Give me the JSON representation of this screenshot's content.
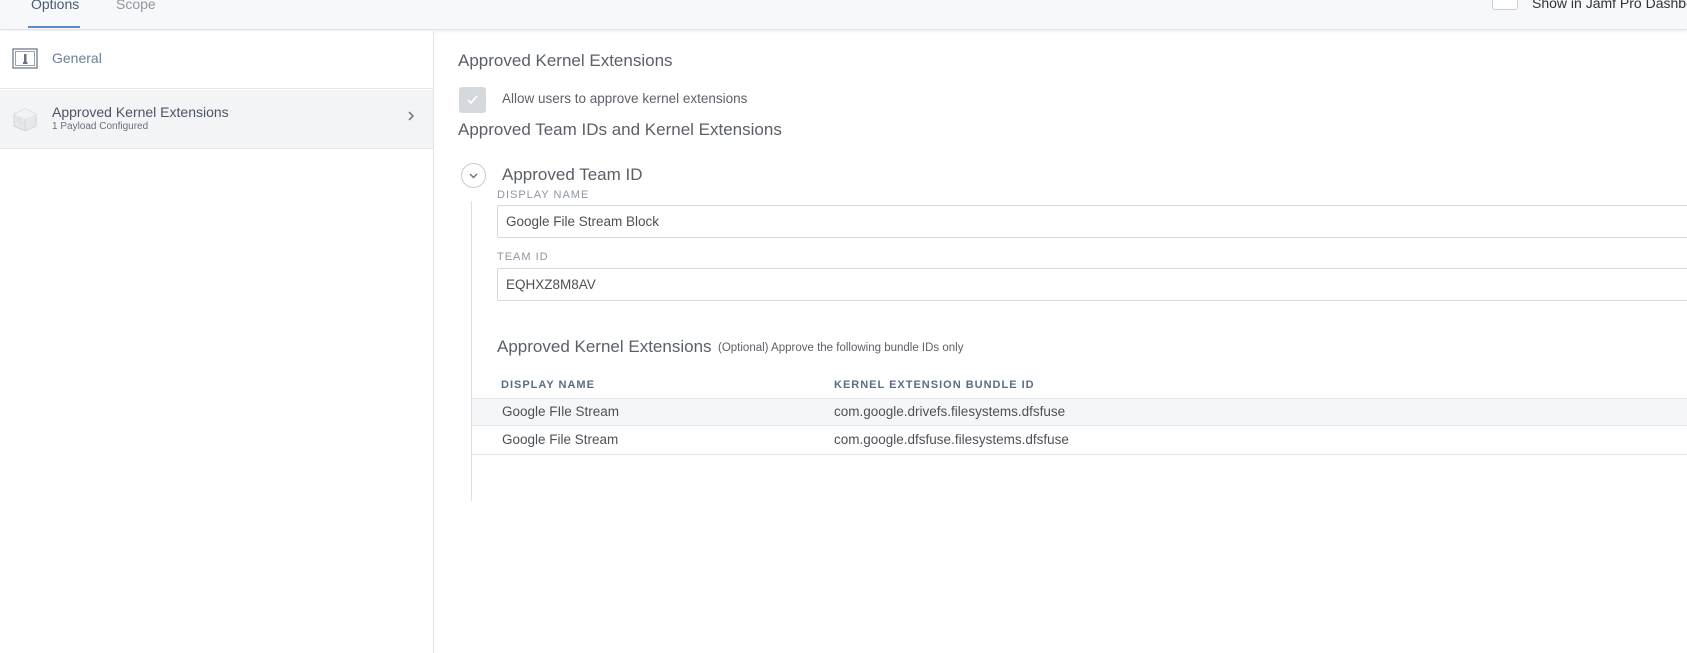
{
  "tabs": [
    {
      "label": "Options"
    },
    {
      "label": "Scope"
    }
  ],
  "header": {
    "dashboard_label": "Show in Jamf Pro Dashbo"
  },
  "sidebar": {
    "items": [
      {
        "label": "General",
        "sublabel": ""
      },
      {
        "label": "Approved Kernel Extensions",
        "sublabel": "1 Payload Configured"
      }
    ]
  },
  "main": {
    "section_title": "Approved Kernel Extensions",
    "allow_users_checkbox": {
      "label": "Allow users to approve kernel extensions",
      "checked": true
    },
    "team_section_title": "Approved Team IDs and Kernel Extensions",
    "team_group": {
      "title": "Approved Team ID",
      "display_name_label": "DISPLAY NAME",
      "display_name_value": "Google File Stream Block",
      "team_id_label": "TEAM ID",
      "team_id_value": "EQHXZ8M8AV",
      "extensions_title": "Approved Kernel Extensions",
      "extensions_hint": "(Optional) Approve the following bundle IDs only",
      "table": {
        "columns": [
          "DISPLAY NAME",
          "KERNEL EXTENSION BUNDLE ID"
        ],
        "rows": [
          [
            "Google FIle Stream",
            "com.google.drivefs.filesystems.dfsfuse"
          ],
          [
            "Google File Stream",
            "com.google.dfsfuse.filesystems.dfsfuse"
          ]
        ]
      }
    }
  },
  "colors": {
    "accent": "#5b8bc9",
    "sidebar_selected_bg": "#f2f4f6",
    "checkbox_checked_bg": "#d5d8dc"
  }
}
